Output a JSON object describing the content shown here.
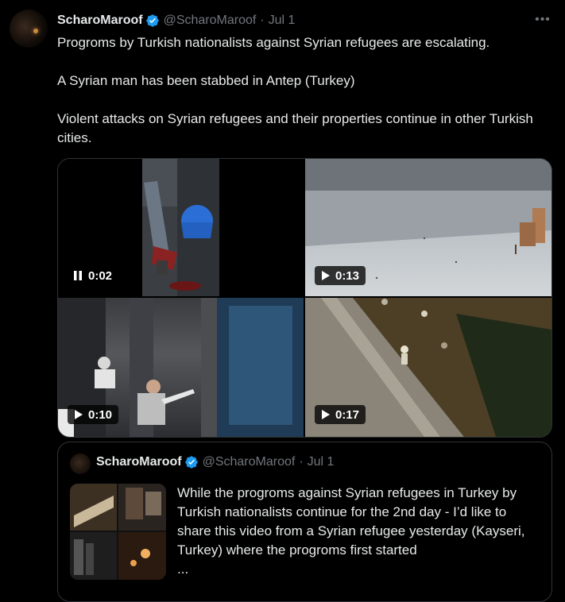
{
  "colors": {
    "background": "#000000",
    "text": "#e7e9ea",
    "muted": "#71767b",
    "border": "#2f3336",
    "verified": "#1d9bf0"
  },
  "tweet": {
    "author_name": "ScharoMaroof",
    "author_handle": "@ScharoMaroof",
    "separator": "·",
    "date": "Jul 1",
    "more_icon": "more-icon",
    "verified_icon": "verified-badge-icon",
    "paragraphs": [
      "Progroms by Turkish nationalists against Syrian refugees are escalating.",
      "A Syrian man has been stabbed in Antep (Turkey)",
      "Violent attacks on Syrian refugees and their properties continue in other Turkish cities."
    ],
    "media": [
      {
        "icon": "pause-icon",
        "duration": "0:02"
      },
      {
        "icon": "play-icon",
        "duration": "0:13"
      },
      {
        "icon": "play-icon",
        "duration": "0:10"
      },
      {
        "icon": "play-icon",
        "duration": "0:17"
      }
    ]
  },
  "quote": {
    "author_name": "ScharoMaroof",
    "author_handle": "@ScharoMaroof",
    "separator": "·",
    "date": "Jul 1",
    "text": "While the progroms against Syrian refugees in Turkey by Turkish nationalists continue for the 2nd day - I’d like to share this video from a Syrian refugee yesterday (Kayseri, Turkey) where the progroms first started",
    "ellipsis": "..."
  }
}
